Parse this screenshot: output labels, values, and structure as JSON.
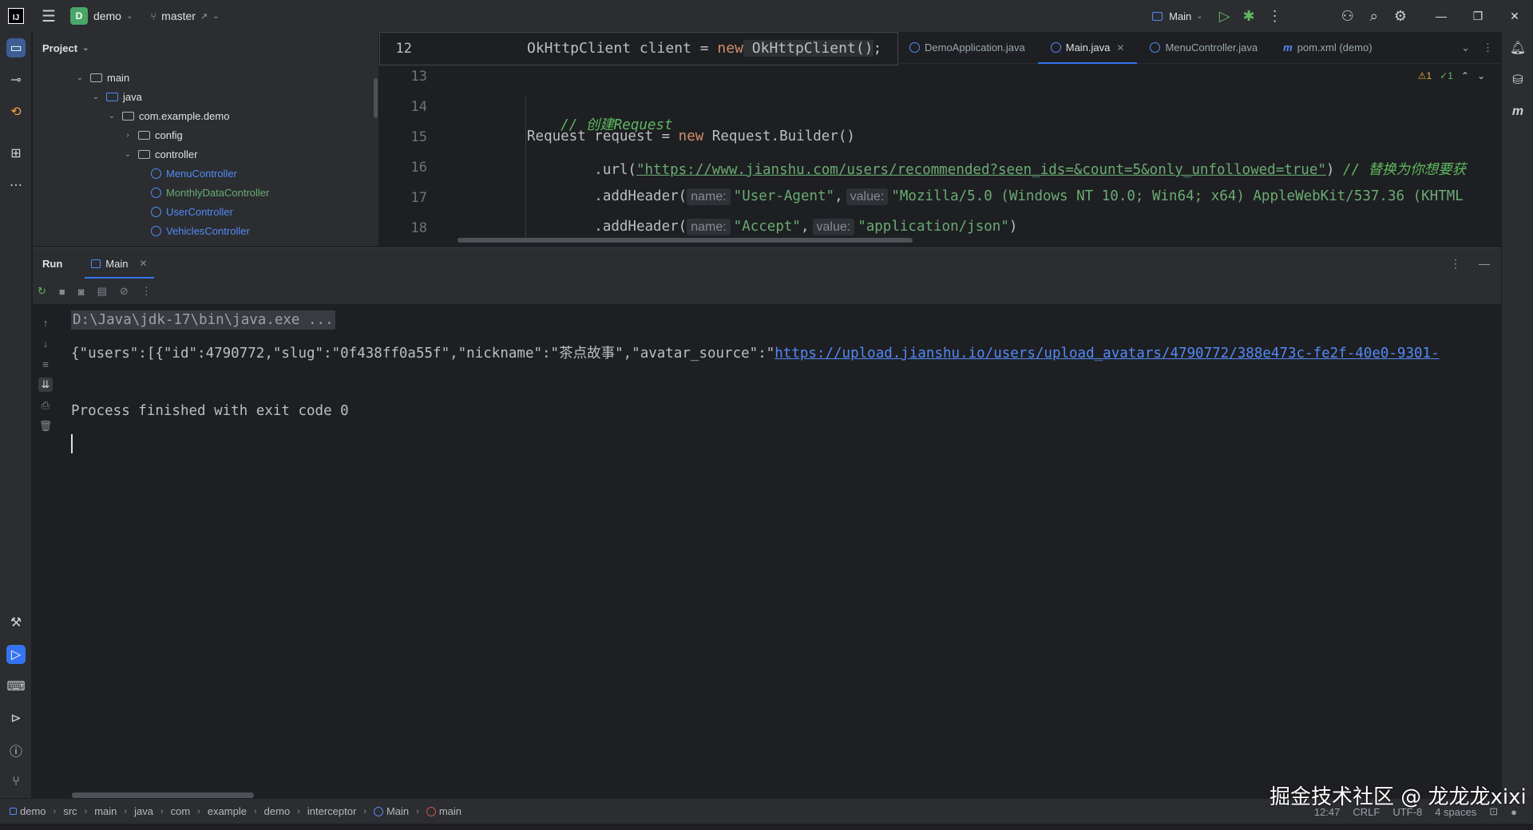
{
  "titlebar": {
    "logo": "IJ",
    "project_badge": "D",
    "project_name": "demo",
    "branch_icon": "git-branch-icon",
    "branch": "master",
    "branch_arrow": "↗",
    "run_config": "Main"
  },
  "project_panel": {
    "title": "Project",
    "tree": [
      {
        "label": "main",
        "kind": "folder"
      },
      {
        "label": "java",
        "kind": "folder"
      },
      {
        "label": "com.example.demo",
        "kind": "package"
      },
      {
        "label": "config",
        "kind": "folder"
      },
      {
        "label": "controller",
        "kind": "folder"
      },
      {
        "label": "MenuController",
        "kind": "class"
      },
      {
        "label": "MonthlyDataController",
        "kind": "class-modified"
      },
      {
        "label": "UserController",
        "kind": "class"
      },
      {
        "label": "VehiclesController",
        "kind": "class"
      }
    ]
  },
  "editor": {
    "tabs": [
      {
        "label": "DemoApplication.java",
        "icon": "class-icon"
      },
      {
        "label": "Main.java",
        "icon": "class-icon",
        "active": true
      },
      {
        "label": "MenuController.java",
        "icon": "class-icon"
      },
      {
        "label": "pom.xml (demo)",
        "icon": "maven-icon"
      }
    ],
    "inspections": {
      "warnings": "1",
      "ok": "1"
    },
    "sticky": {
      "line_number": "12",
      "type": "OkHttpClient",
      "var": " client = ",
      "kw": "new",
      "call": " OkHttpClient()",
      "end": ";"
    },
    "lines": [
      {
        "n": "13"
      },
      {
        "n": "14",
        "comment": "// 创建Request"
      },
      {
        "n": "15",
        "pre": "Request request = ",
        "kw": "new",
        "post": " Request.Builder()"
      },
      {
        "n": "16",
        "pre": "        .url(",
        "str": "\"https://www.jianshu.com/users/recommended?seen_ids=&count=5&only_unfollowed=true\"",
        "post": ") ",
        "comment": "// 替换为你想要获"
      },
      {
        "n": "17",
        "pre": "        .addHeader(",
        "hint1": "name:",
        "str1": "\"User-Agent\"",
        "mid": ",",
        "hint2": "value:",
        "str2": "\"Mozilla/5.0 (Windows NT 10.0; Win64; x64) AppleWebKit/537.36 (KHTML"
      },
      {
        "n": "18",
        "pre": "        .addHeader(",
        "hint1": "name:",
        "str1": "\"Accept\"",
        "mid": ",",
        "hint2": "value:",
        "str2": "\"application/json\"",
        "post": ")"
      }
    ]
  },
  "run_panel": {
    "title": "Run",
    "tab": "Main",
    "console": {
      "command": "D:\\Java\\jdk-17\\bin\\java.exe ...",
      "output_prefix": "{\"users\":[{\"id\":4790772,\"slug\":\"0f438ff0a55f\",\"nickname\":\"茶点故事\",\"avatar_source\":\"",
      "output_link": "https://upload.jianshu.io/users/upload_avatars/4790772/388e473c-fe2f-40e0-9301-",
      "finish": "Process finished with exit code 0"
    }
  },
  "statusbar": {
    "breadcrumbs": [
      "demo",
      "src",
      "main",
      "java",
      "com",
      "example",
      "demo",
      "interceptor",
      "Main",
      "main"
    ],
    "position": "12:47",
    "line_sep": "CRLF",
    "encoding": "UTF-8",
    "indent": "4 spaces"
  },
  "watermark": "掘金技术社区 @ 龙龙龙xixi"
}
